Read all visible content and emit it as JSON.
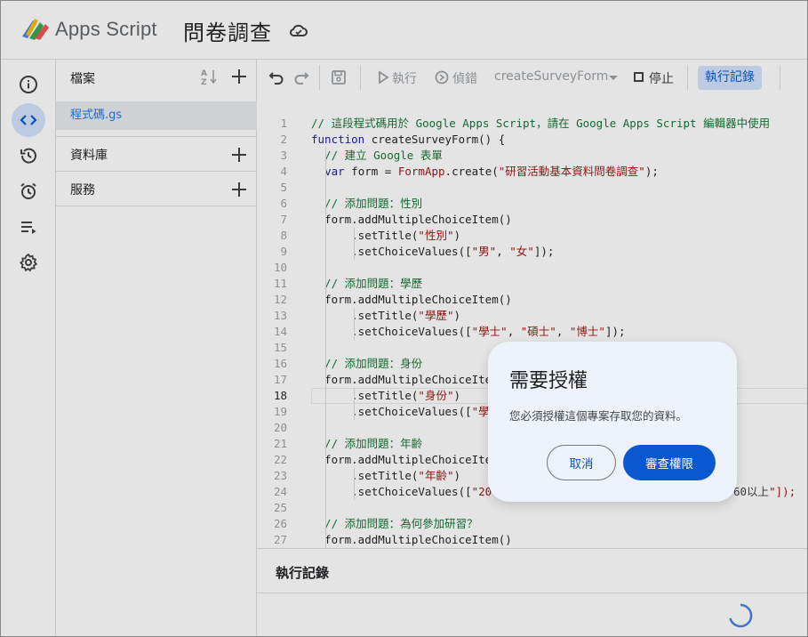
{
  "header": {
    "app_name": "Apps Script",
    "project_title": "問卷調查",
    "logo_icon": "apps-script-logo",
    "cloud_icon": "cloud-synced-icon"
  },
  "rail": {
    "items": [
      {
        "icon": "info-icon",
        "label": "總覽"
      },
      {
        "icon": "code-icon",
        "label": "編輯器",
        "active": true
      },
      {
        "icon": "history-icon",
        "label": "專案記錄"
      },
      {
        "icon": "alarm-icon",
        "label": "觸發條件"
      },
      {
        "icon": "playlist-icon",
        "label": "執行作業"
      },
      {
        "icon": "gear-icon",
        "label": "專案設定"
      }
    ]
  },
  "files": {
    "header": "檔案",
    "file_name": "程式碼.gs",
    "libraries": "資料庫",
    "services": "服務"
  },
  "toolbar": {
    "run": "執行",
    "debug": "偵錯",
    "function_name": "createSurveyForm",
    "stop": "停止",
    "execution_log": "執行記錄"
  },
  "editor": {
    "current_line": 18,
    "lines": [
      "// 這段程式碼用於 Google Apps Script，請在 Google Apps Script 編輯器中使用",
      "function createSurveyForm() {",
      "  // 建立 Google 表單",
      "  var form = FormApp.create(\"研習活動基本資料問卷調查\");",
      "",
      "  // 添加問題：性別",
      "  form.addMultipleChoiceItem()",
      "      .setTitle(\"性別\")",
      "      .setChoiceValues([\"男\", \"女\"]);",
      "",
      "  // 添加問題：學歷",
      "  form.addMultipleChoiceItem()",
      "      .setTitle(\"學歷\")",
      "      .setChoiceValues([\"學士\", \"碩士\", \"博士\"]);",
      "",
      "  // 添加問題：身份",
      "  form.addMultipleChoiceIte",
      "      .setTitle(\"身份\")",
      "      .setChoiceValues([\"學",
      "",
      "  // 添加問題：年齡",
      "  form.addMultipleChoiceIte",
      "      .setTitle(\"年齡\")",
      "      .setChoiceValues([\"20",
      "",
      "  // 添加問題：為何參加研習？",
      "  form.addMultipleChoiceItem()"
    ],
    "line24_tail": "60以上\"]);"
  },
  "exec_panel": {
    "title": "執行記錄"
  },
  "dialog": {
    "title": "需要授權",
    "message": "您必須授權這個專案存取您的資料。",
    "cancel": "取消",
    "review": "審查權限"
  },
  "colors": {
    "accent": "#0b57d0",
    "comment": "#137333",
    "keyword": "#1a1aa6",
    "string": "#a31515"
  }
}
